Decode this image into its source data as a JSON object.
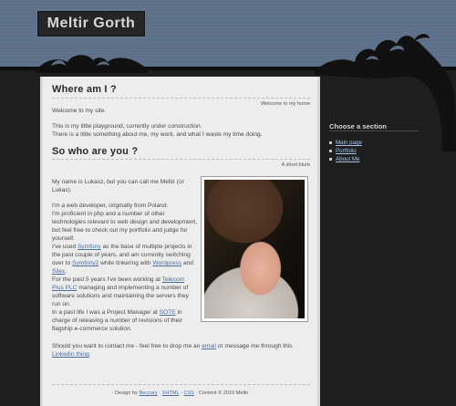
{
  "site": {
    "title": "Meltir Gorth"
  },
  "section1": {
    "heading": "Where am I ?",
    "subtitle": "Welcome to my home",
    "line1": "Welcome to my site.",
    "line2": "This is my little playground, currently under construction.",
    "line3": "There is a little something about me, my work, and what I waste my time doing."
  },
  "section2": {
    "heading": "So who are you ?",
    "subtitle": "A short blurb",
    "p1a": "My name is Lukasz, but you can call me Meltir (or",
    "p1b": "Lukas).",
    "p2": "I'm a web developer, originally from Poland.",
    "p3": "I'm proficient in php and a number of other",
    "p4": "technologies relevant to web design and development,",
    "p5": "but feel free to check out my portfolio and judge for",
    "p6": "yourself.",
    "p7_pre": "I've used ",
    "p7_link": "Symfony",
    "p7_post": " as the base of multiple projects in",
    "p8": "the past couple of years, and am currently switching",
    "p9_pre": "over to ",
    "p9_link1": "Symfony2",
    "p9_mid": " while tinkering with ",
    "p9_link2": "Wordpress",
    "p9_post": " and",
    "p10_link": "Silex",
    "p10_post": ".",
    "p11_pre": "For the past 5 years I've been working at ",
    "p11_link": "Telecom",
    "p12_link": "Plus PLC",
    "p12_post": " managing and implementing a number of",
    "p13": "software solutions and maintaining the servers they",
    "p14": "run on.",
    "p15_pre": "In a past life I was a Project Manager at ",
    "p15_link": "SOTE",
    "p15_post": " in",
    "p16": "charge of releasing a number of revisions of their",
    "p17": "flagship e-commerce solution.",
    "p18_pre": "Should you want to contact me - feel free to drop me an ",
    "p18_link": "email",
    "p18_post": " or message me through this",
    "p19_link": "Linkedin thing",
    "p19_post": "."
  },
  "footer": {
    "pre": "· Design by ",
    "link1": "Beccary",
    "sep1": " · ",
    "link2": "XHTML",
    "sep2": " · ",
    "link3": "CSS",
    "post": " · Content © 2010 Meltir"
  },
  "sidebar": {
    "title": "Choose a section",
    "items": [
      {
        "label": "Main page"
      },
      {
        "label": "Portfolio"
      },
      {
        "label": "About Me"
      }
    ]
  },
  "colors": {
    "background": "#5d7089",
    "dark": "#1e1e1e",
    "content_bg": "#ededed",
    "link": "#4a6fa5",
    "sidebar_link": "#a8c6ea"
  }
}
